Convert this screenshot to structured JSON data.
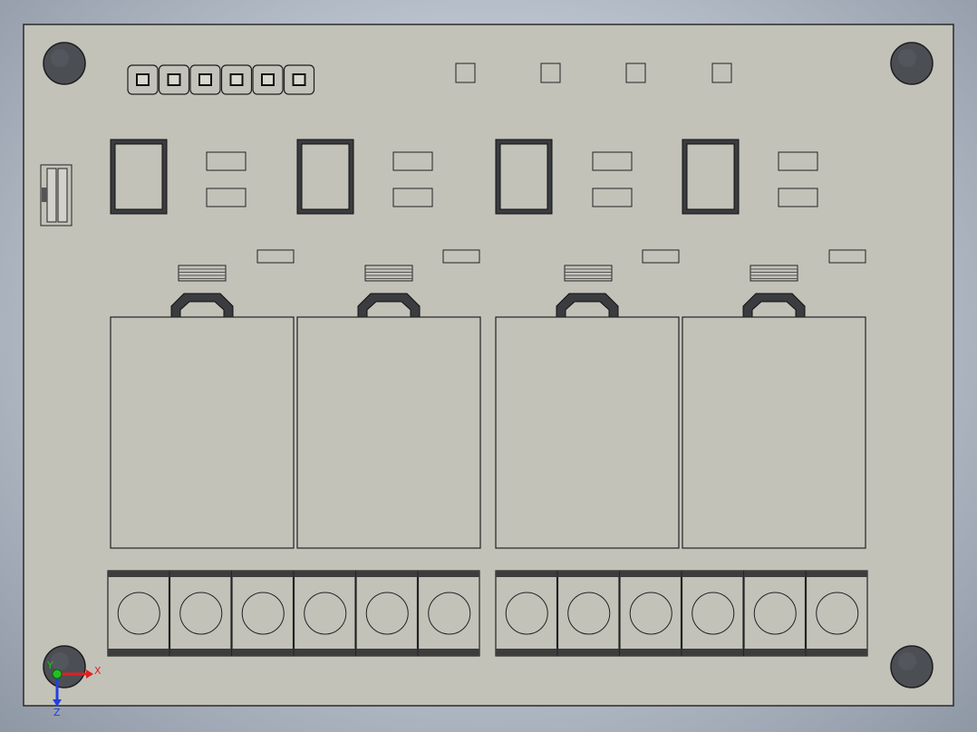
{
  "scene": {
    "view": "top",
    "colors": {
      "board": "#c3c2b9",
      "board_edge": "#2a2a2a",
      "hole": "#4b4f54",
      "component_fill": "#c3c2b9",
      "component_dark": "#3a3c3f",
      "terminal_band": "#3d3d3d",
      "axis_x": "#e02020",
      "axis_y": "#20c020",
      "axis_z": "#2040e0"
    },
    "components": {
      "mounting_hole_count": 4,
      "header_pin_count": 6,
      "test_pad_count": 4,
      "jumper_count": 1,
      "relay_channel_count": 4,
      "relay_icons": [
        "square-ic-icon",
        "resistor-pad-icon",
        "diode-icon",
        "led-icon",
        "relay-body-icon"
      ],
      "terminal_block_groups": 2,
      "screw_terminals_per_group": 6
    }
  },
  "axis_triad": {
    "x_label": "X",
    "y_label": "Y",
    "z_label": "Z"
  }
}
